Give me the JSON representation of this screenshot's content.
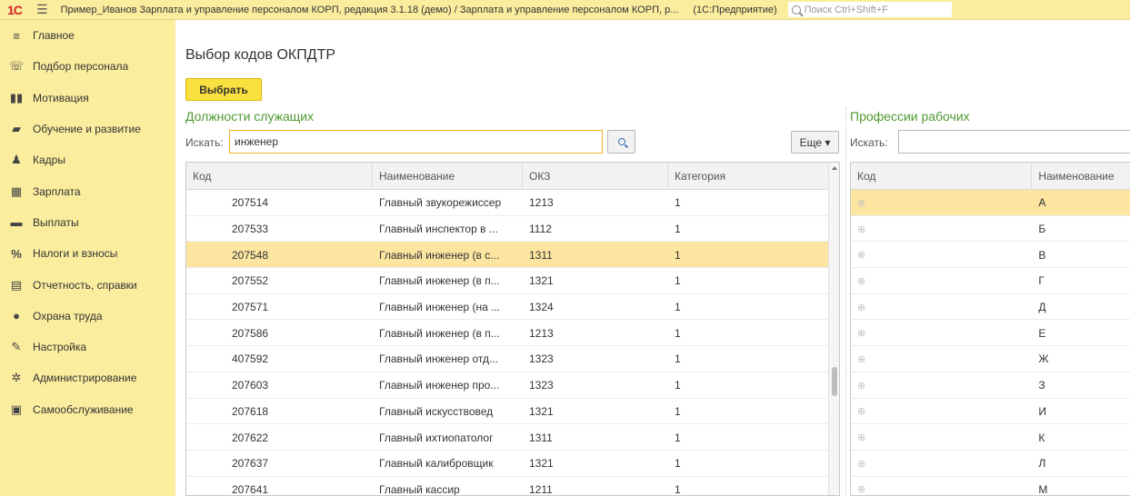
{
  "topbar": {
    "logo": "1С",
    "title": "Пример_Иванов Зарплата и управление персоналом КОРП, редакция 3.1.18 (демо) / Зарплата и управление персоналом КОРП, р...",
    "app": "(1С:Предприятие)",
    "search_placeholder": "Поиск Ctrl+Shift+F"
  },
  "sidebar": {
    "items": [
      {
        "label": "Главное",
        "icon": "menu-icon"
      },
      {
        "label": "Подбор персонала",
        "icon": "person-search-icon"
      },
      {
        "label": "Мотивация",
        "icon": "people-icon"
      },
      {
        "label": "Обучение и развитие",
        "icon": "graduation-icon"
      },
      {
        "label": "Кадры",
        "icon": "staff-icon"
      },
      {
        "label": "Зарплата",
        "icon": "calculator-icon"
      },
      {
        "label": "Выплаты",
        "icon": "wallet-icon"
      },
      {
        "label": "Налоги и взносы",
        "icon": "percent-icon"
      },
      {
        "label": "Отчетность, справки",
        "icon": "report-icon"
      },
      {
        "label": "Охрана труда",
        "icon": "helmet-icon"
      },
      {
        "label": "Настройка",
        "icon": "wrench-icon"
      },
      {
        "label": "Администрирование",
        "icon": "gear-icon"
      },
      {
        "label": "Самообслуживание",
        "icon": "id-card-icon"
      }
    ]
  },
  "main": {
    "title": "Выбор кодов ОКПДТР",
    "select_button": "Выбрать",
    "left": {
      "section_title": "Должности служащих",
      "search_label": "Искать:",
      "search_value": "инженер",
      "more_button": "Еще ▾",
      "columns": [
        "Код",
        "Наименование",
        "ОКЗ",
        "Категория"
      ],
      "rows": [
        {
          "code": "207514",
          "name": "Главный звукорежиссер",
          "okz": "1213",
          "cat": "1",
          "selected": false
        },
        {
          "code": "207533",
          "name": "Главный инспектор в ...",
          "okz": "1112",
          "cat": "1",
          "selected": false
        },
        {
          "code": "207548",
          "name": "Главный инженер (в с...",
          "okz": "1311",
          "cat": "1",
          "selected": true
        },
        {
          "code": "207552",
          "name": "Главный инженер (в п...",
          "okz": "1321",
          "cat": "1",
          "selected": false
        },
        {
          "code": "207571",
          "name": "Главный инженер (на ...",
          "okz": "1324",
          "cat": "1",
          "selected": false
        },
        {
          "code": "207586",
          "name": "Главный инженер (в п...",
          "okz": "1213",
          "cat": "1",
          "selected": false
        },
        {
          "code": "407592",
          "name": "Главный инженер отд...",
          "okz": "1323",
          "cat": "1",
          "selected": false
        },
        {
          "code": "207603",
          "name": "Главный инженер про...",
          "okz": "1323",
          "cat": "1",
          "selected": false
        },
        {
          "code": "207618",
          "name": "Главный искусствовед",
          "okz": "1321",
          "cat": "1",
          "selected": false
        },
        {
          "code": "207622",
          "name": "Главный ихтиопатолог",
          "okz": "1311",
          "cat": "1",
          "selected": false
        },
        {
          "code": "207637",
          "name": "Главный калибровщик",
          "okz": "1321",
          "cat": "1",
          "selected": false
        },
        {
          "code": "207641",
          "name": "Главный кассир",
          "okz": "1211",
          "cat": "1",
          "selected": false
        }
      ]
    },
    "right": {
      "section_title": "Профессии рабочих",
      "search_label": "Искать:",
      "search_value": "",
      "columns": [
        "Код",
        "Наименование"
      ],
      "rows": [
        {
          "code": "⊕",
          "name": "А",
          "selected": true
        },
        {
          "code": "⊕",
          "name": "Б",
          "selected": false
        },
        {
          "code": "⊕",
          "name": "В",
          "selected": false
        },
        {
          "code": "⊕",
          "name": "Г",
          "selected": false
        },
        {
          "code": "⊕",
          "name": "Д",
          "selected": false
        },
        {
          "code": "⊕",
          "name": "Е",
          "selected": false
        },
        {
          "code": "⊕",
          "name": "Ж",
          "selected": false
        },
        {
          "code": "⊕",
          "name": "З",
          "selected": false
        },
        {
          "code": "⊕",
          "name": "И",
          "selected": false
        },
        {
          "code": "⊕",
          "name": "К",
          "selected": false
        },
        {
          "code": "⊕",
          "name": "Л",
          "selected": false
        },
        {
          "code": "⊕",
          "name": "М",
          "selected": false
        }
      ]
    }
  }
}
